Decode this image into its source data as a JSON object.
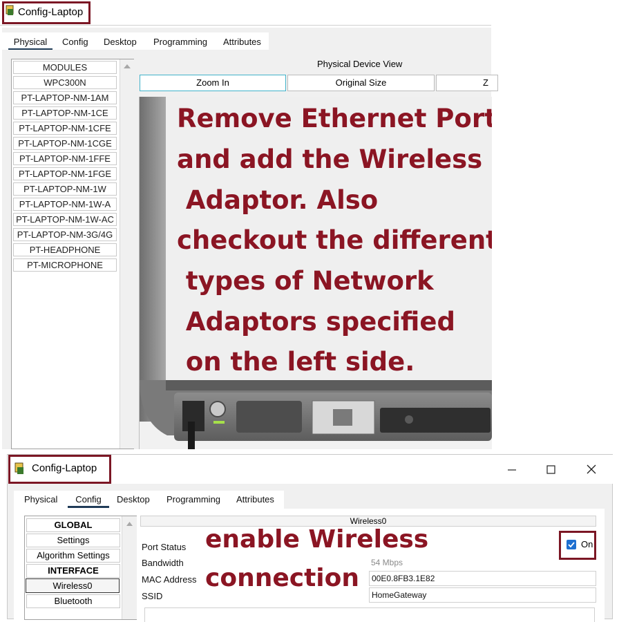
{
  "top": {
    "window_title": "Config-Laptop",
    "tabs": [
      "Physical",
      "Config",
      "Desktop",
      "Programming",
      "Attributes"
    ],
    "active_tab": 0,
    "modules": [
      "MODULES",
      "WPC300N",
      "PT-LAPTOP-NM-1AM",
      "PT-LAPTOP-NM-1CE",
      "PT-LAPTOP-NM-1CFE",
      "PT-LAPTOP-NM-1CGE",
      "PT-LAPTOP-NM-1FFE",
      "PT-LAPTOP-NM-1FGE",
      "PT-LAPTOP-NM-1W",
      "PT-LAPTOP-NM-1W-A",
      "PT-LAPTOP-NM-1W-AC",
      "PT-LAPTOP-NM-3G/4G",
      "PT-HEADPHONE",
      "PT-MICROPHONE"
    ],
    "view_title": "Physical Device View",
    "zoom_in": "Zoom In",
    "original_size": "Original Size",
    "zoom_out_partial": "Z",
    "annotation": [
      "Remove Ethernet Port",
      "and add the Wireless",
      " Adaptor. Also",
      "checkout the different",
      " types of Network",
      " Adaptors specified",
      " on the left side."
    ]
  },
  "bottom": {
    "window_title": "Config-Laptop",
    "tabs": [
      "Physical",
      "Config",
      "Desktop",
      "Programming",
      "Attributes"
    ],
    "active_tab": 1,
    "sidebar": {
      "global_header": "GLOBAL",
      "settings": "Settings",
      "algorithm_settings": "Algorithm Settings",
      "interface_header": "INTERFACE",
      "wireless0": "Wireless0",
      "bluetooth": "Bluetooth"
    },
    "panel_title": "Wireless0",
    "port_status_label": "Port Status",
    "on_label": "On",
    "port_on": true,
    "bandwidth_label": "Bandwidth",
    "bandwidth_value": "54 Mbps",
    "mac_label": "MAC Address",
    "mac_value": "00E0.8FB3.1E82",
    "ssid_label": "SSID",
    "ssid_value": "HomeGateway",
    "annotation": [
      "enable Wireless",
      "connection"
    ]
  },
  "colors": {
    "annotation": "#8b1523",
    "frame": "#7b1624",
    "accent": "#1f3b57",
    "checkbox": "#1e6fd0"
  }
}
